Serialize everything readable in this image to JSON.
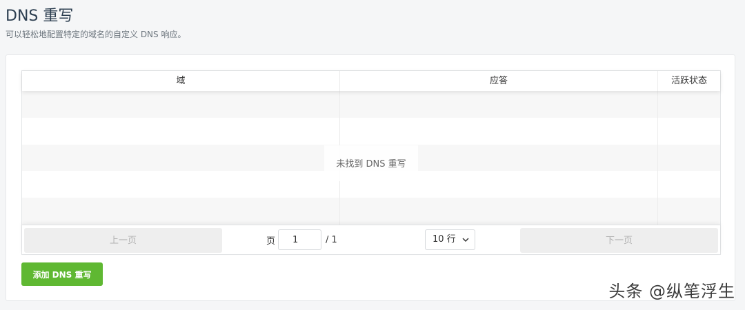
{
  "header": {
    "title": "DNS 重写",
    "subtitle": "可以轻松地配置特定的域名的自定义 DNS 响应。"
  },
  "table": {
    "columns": [
      "域",
      "应答",
      "活跃状态"
    ],
    "empty_text": "未找到 DNS 重写",
    "rows": []
  },
  "pagination": {
    "prev_label": "上一页",
    "page_label": "页",
    "page_value": "1",
    "total_pages": "/ 1",
    "page_size": "10 行",
    "next_label": "下一页"
  },
  "actions": {
    "add_label": "添加 DNS 重写"
  },
  "watermark": {
    "text": "头条 @纵笔浮生"
  },
  "colors": {
    "accent_green": "#5fb832",
    "background": "#f5f6f7"
  }
}
